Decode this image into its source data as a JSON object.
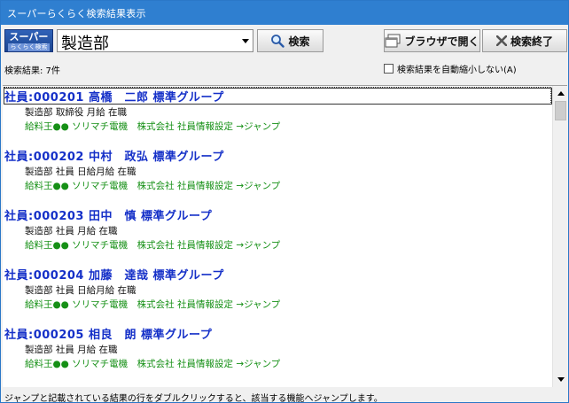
{
  "window": {
    "title": "スーパーらくらく検索結果表示"
  },
  "logo": {
    "line1": "スーパー",
    "line2": "らくらく検索"
  },
  "search": {
    "value": "製造部"
  },
  "buttons": {
    "search": "検索",
    "open_browser": "ブラウザで開く",
    "close": "検索終了"
  },
  "status": {
    "count": "検索結果: 7件"
  },
  "auto_shrink": {
    "label": "検索結果を自動縮小しない(A)",
    "checked": false
  },
  "results": [
    {
      "header": "社員:000201 高橋　二郎 標準グループ",
      "detail": "製造部 取締役 月給 在職",
      "link": "給料王●● ソリマチ電機　株式会社 社員情報設定 →ジャンプ",
      "selected": true
    },
    {
      "header": "社員:000202 中村　政弘 標準グループ",
      "detail": "製造部 社員 日給月給 在職",
      "link": "給料王●● ソリマチ電機　株式会社 社員情報設定 →ジャンプ",
      "selected": false
    },
    {
      "header": "社員:000203 田中　慎 標準グループ",
      "detail": "製造部 社員 月給 在職",
      "link": "給料王●● ソリマチ電機　株式会社 社員情報設定 →ジャンプ",
      "selected": false
    },
    {
      "header": "社員:000204 加藤　達哉 標準グループ",
      "detail": "製造部 社員 日給月給 在職",
      "link": "給料王●● ソリマチ電機　株式会社 社員情報設定 →ジャンプ",
      "selected": false
    },
    {
      "header": "社員:000205 相良　朗 標準グループ",
      "detail": "製造部 社員 月給 在職",
      "link": "給料王●● ソリマチ電機　株式会社 社員情報設定 →ジャンプ",
      "selected": false
    }
  ],
  "footer": {
    "hint": "ジャンプと記載されている結果の行をダブルクリックすると、該当する機能へジャンプします。"
  },
  "icons": {
    "search": "magnifier-icon",
    "browser": "window-icon",
    "close": "x-icon",
    "dropdown": "triangle-down-icon"
  },
  "colors": {
    "titlebar": "#2f7fd0",
    "result_header": "#1530c8",
    "result_link": "#169016"
  }
}
